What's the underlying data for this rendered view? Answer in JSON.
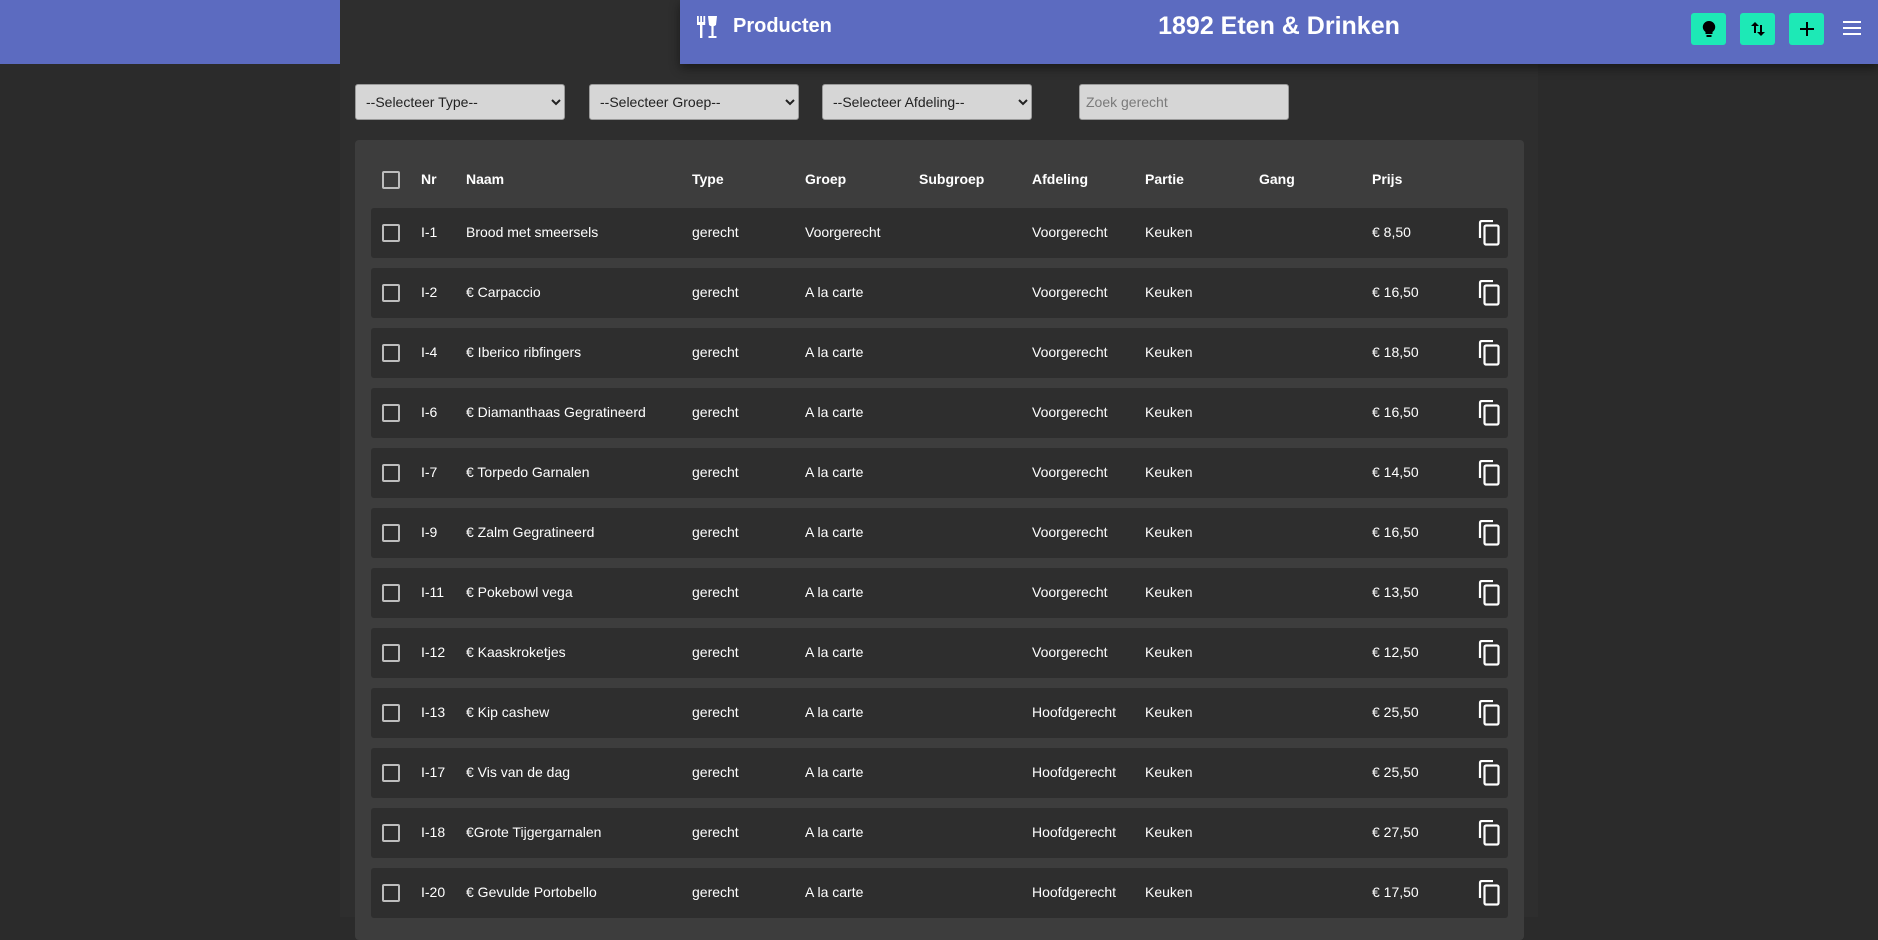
{
  "header": {
    "section_title": "Producten",
    "app_title": "1892 Eten & Drinken",
    "icons": {
      "brand": "food-drink-icon",
      "idea": "lightbulb-icon",
      "sort": "swap-vertical-icon",
      "add": "plus-icon",
      "menu": "hamburger-menu-icon"
    },
    "colors": {
      "bar": "#5c6bc0",
      "button": "#1de9b6"
    }
  },
  "filters": {
    "type": "--Selecteer Type--",
    "groep": "--Selecteer Groep--",
    "afdeling": "--Selecteer Afdeling--",
    "search_placeholder": "Zoek gerecht"
  },
  "table": {
    "columns": {
      "nr": "Nr",
      "naam": "Naam",
      "type": "Type",
      "groep": "Groep",
      "subgroep": "Subgroep",
      "afdeling": "Afdeling",
      "partie": "Partie",
      "gang": "Gang",
      "prijs": "Prijs"
    },
    "rows": [
      {
        "nr": "I-1",
        "naam": "Brood met smeersels",
        "type": "gerecht",
        "groep": "Voorgerecht",
        "subgroep": "",
        "afdeling": "Voorgerecht",
        "partie": "Keuken",
        "gang": "",
        "prijs": "€ 8,50"
      },
      {
        "nr": "I-2",
        "naam": "€ Carpaccio",
        "type": "gerecht",
        "groep": "A la carte",
        "subgroep": "",
        "afdeling": "Voorgerecht",
        "partie": "Keuken",
        "gang": "",
        "prijs": "€ 16,50"
      },
      {
        "nr": "I-4",
        "naam": "€ Iberico ribfingers",
        "type": "gerecht",
        "groep": "A la carte",
        "subgroep": "",
        "afdeling": "Voorgerecht",
        "partie": "Keuken",
        "gang": "",
        "prijs": "€ 18,50"
      },
      {
        "nr": "I-6",
        "naam": "€ Diamanthaas Gegratineerd",
        "type": "gerecht",
        "groep": "A la carte",
        "subgroep": "",
        "afdeling": "Voorgerecht",
        "partie": "Keuken",
        "gang": "",
        "prijs": "€ 16,50"
      },
      {
        "nr": "I-7",
        "naam": "€ Torpedo Garnalen",
        "type": "gerecht",
        "groep": "A la carte",
        "subgroep": "",
        "afdeling": "Voorgerecht",
        "partie": "Keuken",
        "gang": "",
        "prijs": "€ 14,50"
      },
      {
        "nr": "I-9",
        "naam": "€ Zalm Gegratineerd",
        "type": "gerecht",
        "groep": "A la carte",
        "subgroep": "",
        "afdeling": "Voorgerecht",
        "partie": "Keuken",
        "gang": "",
        "prijs": "€ 16,50"
      },
      {
        "nr": "I-11",
        "naam": "€ Pokebowl vega",
        "type": "gerecht",
        "groep": "A la carte",
        "subgroep": "",
        "afdeling": "Voorgerecht",
        "partie": "Keuken",
        "gang": "",
        "prijs": "€ 13,50"
      },
      {
        "nr": "I-12",
        "naam": "€ Kaaskroketjes",
        "type": "gerecht",
        "groep": "A la carte",
        "subgroep": "",
        "afdeling": "Voorgerecht",
        "partie": "Keuken",
        "gang": "",
        "prijs": "€ 12,50"
      },
      {
        "nr": "I-13",
        "naam": "€ Kip cashew",
        "type": "gerecht",
        "groep": "A la carte",
        "subgroep": "",
        "afdeling": "Hoofdgerecht",
        "partie": "Keuken",
        "gang": "",
        "prijs": "€ 25,50"
      },
      {
        "nr": "I-17",
        "naam": "€ Vis van de dag",
        "type": "gerecht",
        "groep": "A la carte",
        "subgroep": "",
        "afdeling": "Hoofdgerecht",
        "partie": "Keuken",
        "gang": "",
        "prijs": "€ 25,50"
      },
      {
        "nr": "I-18",
        "naam": "€Grote Tijgergarnalen",
        "type": "gerecht",
        "groep": "A la carte",
        "subgroep": "",
        "afdeling": "Hoofdgerecht",
        "partie": "Keuken",
        "gang": "",
        "prijs": "€ 27,50"
      },
      {
        "nr": "I-20",
        "naam": "€ Gevulde Portobello",
        "type": "gerecht",
        "groep": "A la carte",
        "subgroep": "",
        "afdeling": "Hoofdgerecht",
        "partie": "Keuken",
        "gang": "",
        "prijs": "€ 17,50"
      }
    ]
  }
}
